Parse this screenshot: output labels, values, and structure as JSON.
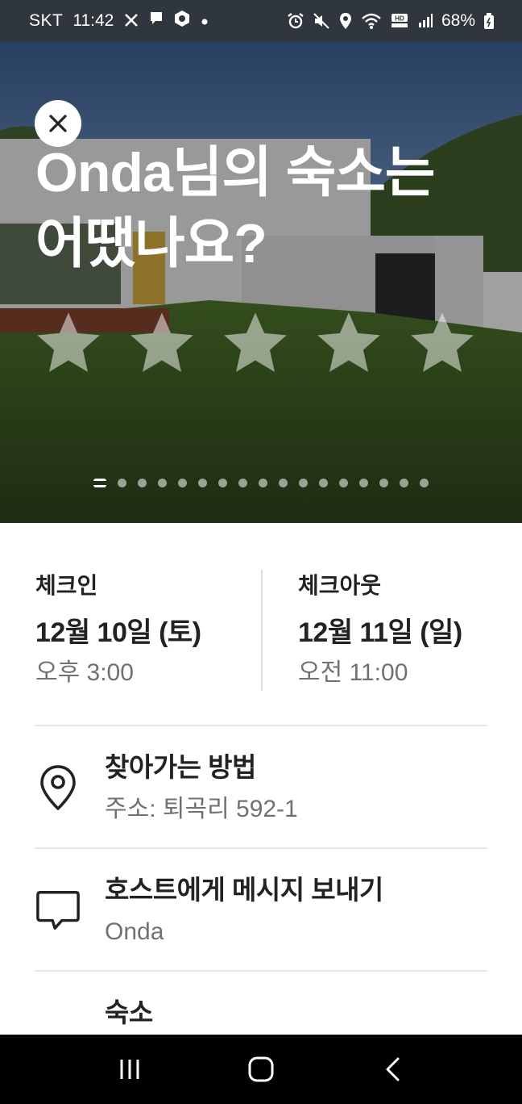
{
  "status_bar": {
    "carrier": "SKT",
    "time": "11:42",
    "battery": "68%"
  },
  "hero": {
    "title_line1": "Onda님의 숙소는",
    "title_line2": "어땠나요?",
    "rating_stars": 5,
    "photo_count": 17,
    "active_photo": 1
  },
  "checkin": {
    "label": "체크인",
    "date": "12월 10일 (토)",
    "time": "오후 3:00"
  },
  "checkout": {
    "label": "체크아웃",
    "date": "12월 11일 (일)",
    "time": "오전 11:00"
  },
  "directions": {
    "title": "찾아가는 방법",
    "subtitle": "주소: 퇴곡리 592-1"
  },
  "message_host": {
    "title": "호스트에게 메시지 보내기",
    "subtitle": "Onda"
  },
  "listing": {
    "title": "숙소"
  },
  "icons": [
    "close-icon",
    "star-icon",
    "location-pin-icon",
    "message-icon",
    "recent-apps-icon",
    "home-icon",
    "back-icon"
  ]
}
